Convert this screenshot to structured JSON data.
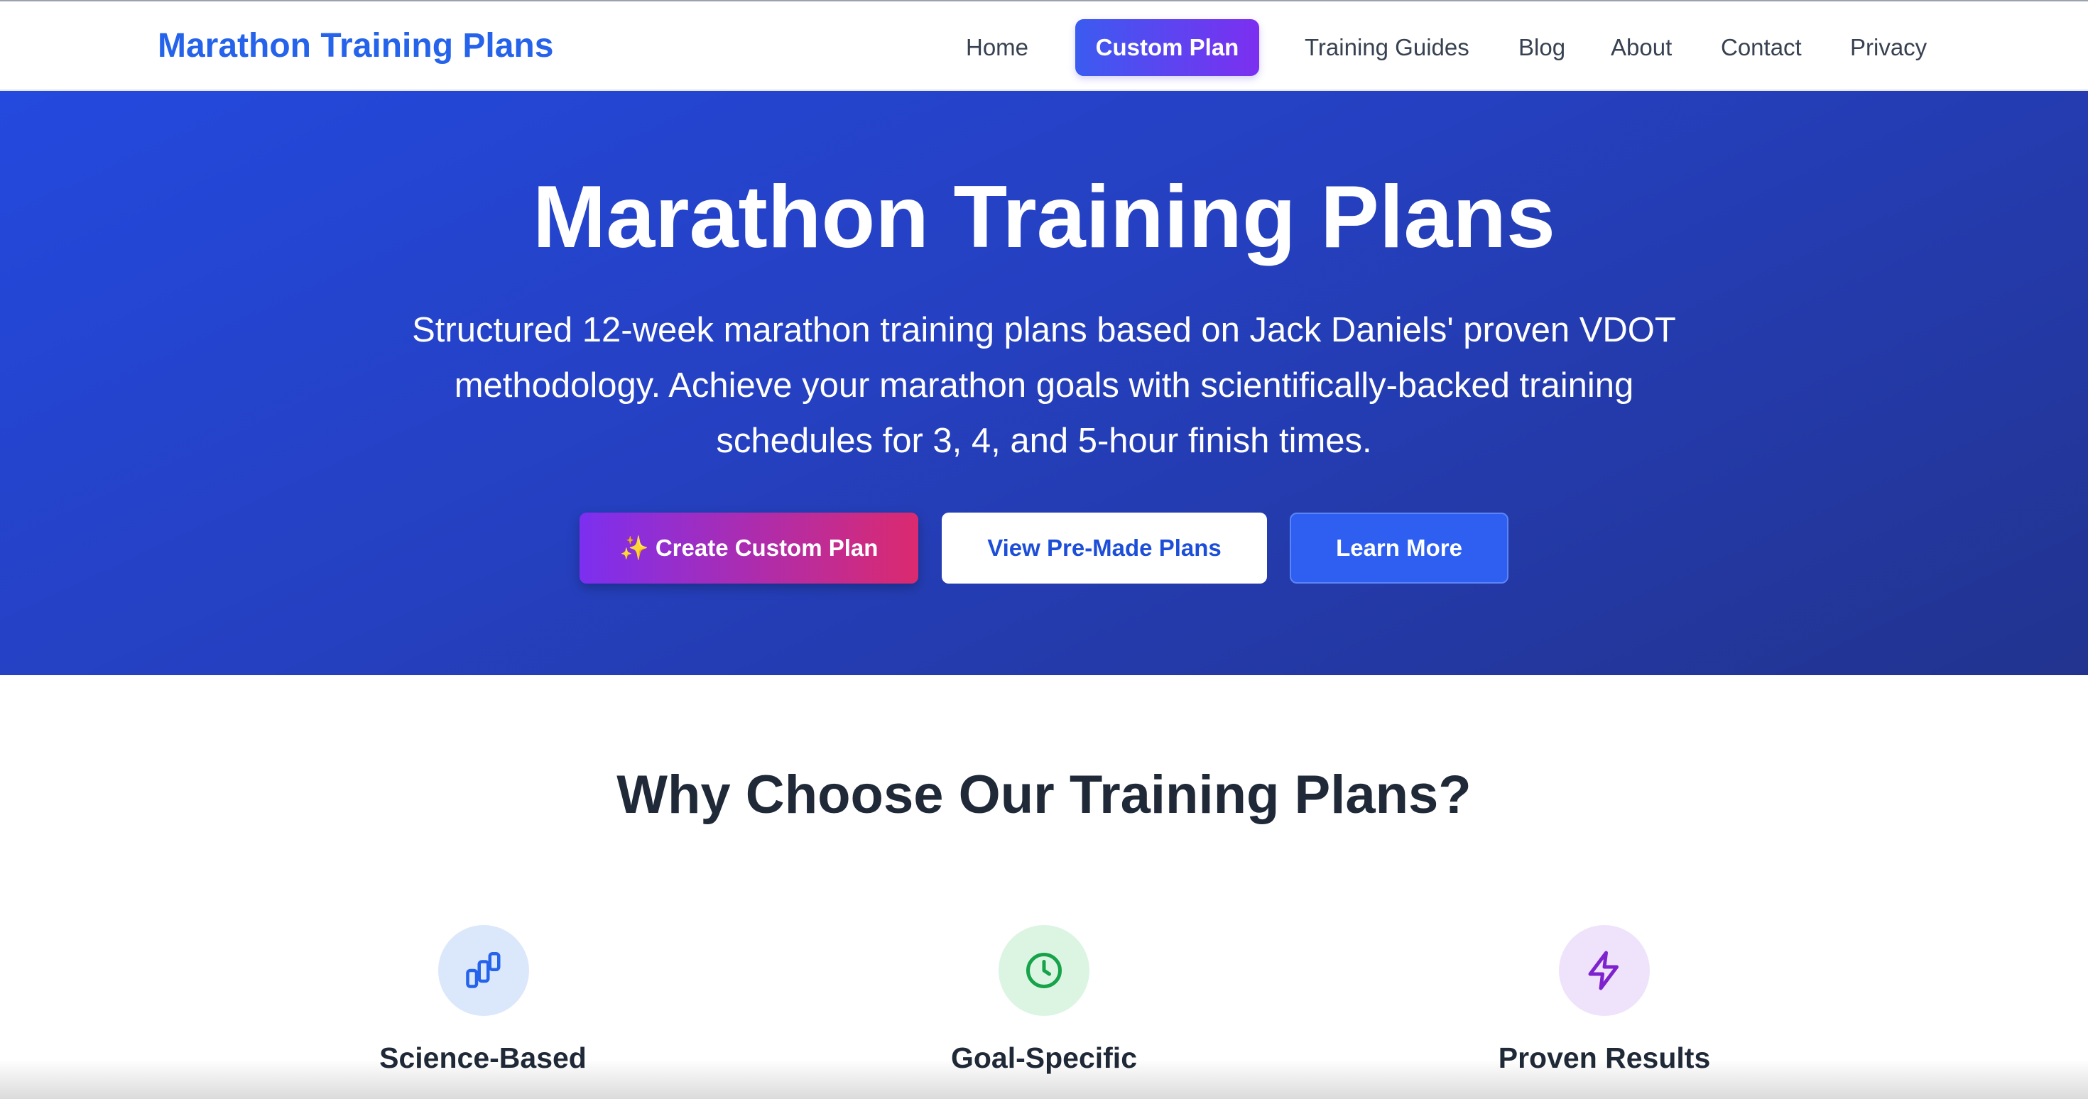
{
  "nav": {
    "brand": "Marathon Training Plans",
    "items": [
      {
        "label": "Home"
      },
      {
        "label": "Custom Plan"
      },
      {
        "label": "Training Guides"
      },
      {
        "label": "Blog"
      },
      {
        "label": "About"
      },
      {
        "label": "Contact"
      },
      {
        "label": "Privacy"
      }
    ]
  },
  "hero": {
    "title": "Marathon Training Plans",
    "subtitle": "Structured 12-week marathon training plans based on Jack Daniels' proven VDOT methodology. Achieve your marathon goals with scientifically-backed training schedules for 3, 4, and 5-hour finish times.",
    "buttons": {
      "create": "✨ Create Custom Plan",
      "premade": "View Pre-Made Plans",
      "learn": "Learn More"
    }
  },
  "why": {
    "title": "Why Choose Our Training Plans?",
    "features": [
      {
        "title": "Science-Based",
        "icon": "chart-bars-icon"
      },
      {
        "title": "Goal-Specific",
        "icon": "clock-icon"
      },
      {
        "title": "Proven Results",
        "icon": "lightning-icon"
      }
    ]
  },
  "colors": {
    "brand": "#2563eb",
    "hero_gradient_start": "#2449de",
    "hero_gradient_end": "#22338f",
    "cta_gradient_start": "#7c2ff0",
    "cta_gradient_end": "#db2a6f"
  }
}
